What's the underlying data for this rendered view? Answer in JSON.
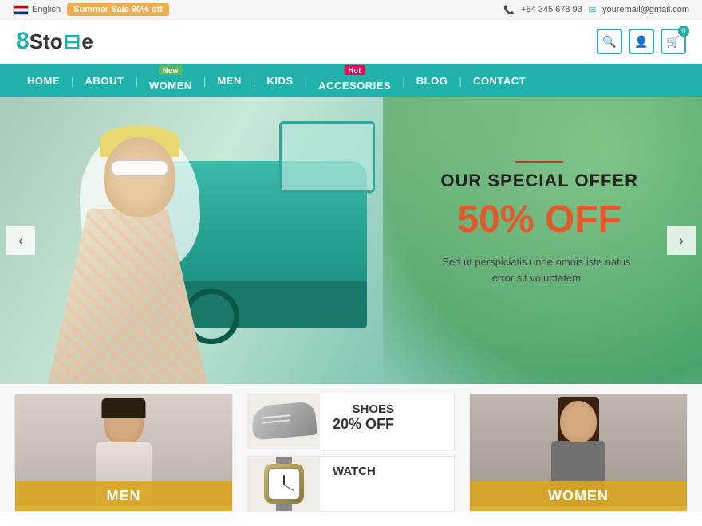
{
  "topbar": {
    "lang": "English",
    "sale_text": "Summer Sale 90% off",
    "phone": "+84 345 678 93",
    "email": "youremail@gmail.com"
  },
  "header": {
    "logo_8": "8",
    "logo_text": "Store",
    "cart_count": "0"
  },
  "nav": {
    "items": [
      {
        "label": "HOME",
        "badge": null
      },
      {
        "label": "ABOUT",
        "badge": null
      },
      {
        "label": "WOMEN",
        "badge": "New"
      },
      {
        "label": "MEN",
        "badge": null
      },
      {
        "label": "KIDS",
        "badge": null
      },
      {
        "label": "ACCESORIES",
        "badge": "Hot"
      },
      {
        "label": "BLOG",
        "badge": null
      },
      {
        "label": "CONTACT",
        "badge": null
      }
    ]
  },
  "hero": {
    "line_color": "#c0392b",
    "title": "OUR SPECIAL OFFER",
    "offer": "50% OFF",
    "description": "Sed ut perspiciatis unde omnis iste natus error sit voluptatem"
  },
  "slider": {
    "prev_label": "‹",
    "next_label": "›"
  },
  "products": {
    "men": {
      "label": "MEN"
    },
    "shoes": {
      "name": "SHOES",
      "discount": "20%",
      "off": "OFF"
    },
    "women": {
      "label": "WOMEN"
    },
    "watch": {
      "name": "WATCH"
    }
  }
}
